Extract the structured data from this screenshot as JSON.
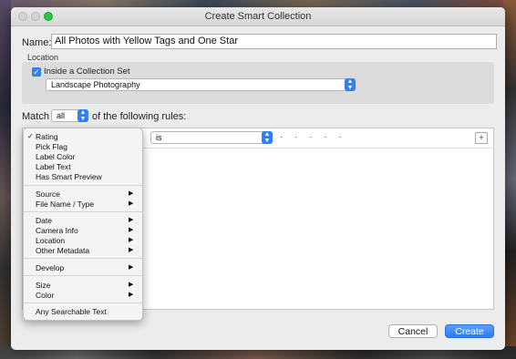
{
  "window": {
    "title": "Create Smart Collection"
  },
  "form": {
    "name_label": "Name:",
    "name_value": "All Photos with Yellow Tags and One Star",
    "location_label": "Location",
    "inside_collection_set_label": "Inside a Collection Set",
    "inside_collection_set_checked": true,
    "collection_set_value": "Landscape Photography",
    "match_label": "Match",
    "match_value": "all",
    "rules_label": "of the following rules:"
  },
  "rule": {
    "operator_value": "is",
    "value_placeholder": "· · · · ·",
    "add_label": "+"
  },
  "menu": {
    "groups": [
      [
        "Rating",
        "Pick Flag",
        "Label Color",
        "Label Text",
        "Has Smart Preview"
      ],
      [
        "Source",
        "File Name / Type"
      ],
      [
        "Date",
        "Camera Info",
        "Location",
        "Other Metadata"
      ],
      [
        "Develop"
      ],
      [
        "Size",
        "Color"
      ],
      [
        "Any Searchable Text"
      ]
    ],
    "checked_item": "Rating",
    "checkmark": "✓",
    "submenu_arrow": "▶"
  },
  "buttons": {
    "cancel": "Cancel",
    "create": "Create"
  },
  "colors": {
    "accent": "#2f7ff6",
    "close_light": "#28c840"
  }
}
